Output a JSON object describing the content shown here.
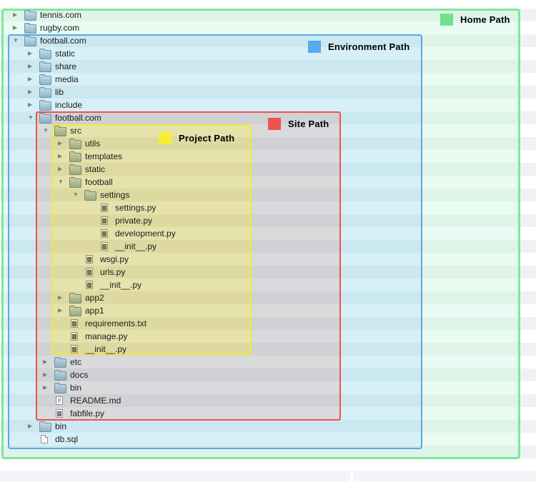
{
  "legend": [
    {
      "id": "home",
      "label": "Home Path",
      "color": "#71e28c",
      "border": "#7ee897"
    },
    {
      "id": "environment",
      "label": "Environment Path",
      "color": "#57a9f0",
      "border": "#5aa7ec"
    },
    {
      "id": "site",
      "label": "Site Path",
      "color": "#ee5350",
      "border": "#ef5251"
    },
    {
      "id": "project",
      "label": "Project Path",
      "color": "#f8ec39",
      "border": "#f6e838"
    }
  ],
  "icons": {
    "collapsed-triangle": "▶",
    "expanded-triangle": "▼",
    "markdown-glyph": "#"
  },
  "tree": {
    "rows": [
      {
        "label": "tennis.com",
        "level": 1,
        "type": "folder",
        "state": "collapsed",
        "zone": "home"
      },
      {
        "label": "rugby.com",
        "level": 1,
        "type": "folder",
        "state": "collapsed",
        "zone": "home"
      },
      {
        "label": "football.com",
        "level": 1,
        "type": "folder",
        "state": "expanded",
        "zone": "env"
      },
      {
        "label": "static",
        "level": 2,
        "type": "folder",
        "state": "collapsed",
        "zone": "env"
      },
      {
        "label": "share",
        "level": 2,
        "type": "folder",
        "state": "collapsed",
        "zone": "env"
      },
      {
        "label": "media",
        "level": 2,
        "type": "folder",
        "state": "collapsed",
        "zone": "env"
      },
      {
        "label": "lib",
        "level": 2,
        "type": "folder",
        "state": "collapsed",
        "zone": "env"
      },
      {
        "label": "include",
        "level": 2,
        "type": "folder",
        "state": "collapsed",
        "zone": "env"
      },
      {
        "label": "football.com",
        "level": 2,
        "type": "folder",
        "state": "expanded",
        "zone": "site"
      },
      {
        "label": "src",
        "level": 3,
        "type": "folder",
        "state": "expanded",
        "zone": "project"
      },
      {
        "label": "utils",
        "level": 4,
        "type": "folder",
        "state": "collapsed",
        "zone": "project"
      },
      {
        "label": "templates",
        "level": 4,
        "type": "folder",
        "state": "collapsed",
        "zone": "project"
      },
      {
        "label": "static",
        "level": 4,
        "type": "folder",
        "state": "collapsed",
        "zone": "project"
      },
      {
        "label": "football",
        "level": 4,
        "type": "folder",
        "state": "expanded",
        "zone": "project"
      },
      {
        "label": "settings",
        "level": 5,
        "type": "folder",
        "state": "expanded",
        "zone": "project"
      },
      {
        "label": "settings.py",
        "level": 6,
        "type": "file",
        "state": "",
        "zone": "project"
      },
      {
        "label": "private.py",
        "level": 6,
        "type": "file",
        "state": "",
        "zone": "project"
      },
      {
        "label": "development.py",
        "level": 6,
        "type": "file",
        "state": "",
        "zone": "project"
      },
      {
        "label": "__init__.py",
        "level": 6,
        "type": "file",
        "state": "",
        "zone": "project"
      },
      {
        "label": "wsgi.py",
        "level": 5,
        "type": "file",
        "state": "",
        "zone": "project"
      },
      {
        "label": "urls.py",
        "level": 5,
        "type": "file",
        "state": "",
        "zone": "project"
      },
      {
        "label": "__init__.py",
        "level": 5,
        "type": "file",
        "state": "",
        "zone": "project"
      },
      {
        "label": "app2",
        "level": 4,
        "type": "folder",
        "state": "collapsed",
        "zone": "project"
      },
      {
        "label": "app1",
        "level": 4,
        "type": "folder",
        "state": "collapsed",
        "zone": "project"
      },
      {
        "label": "requirements.txt",
        "level": 4,
        "type": "file",
        "state": "",
        "zone": "project"
      },
      {
        "label": "manage.py",
        "level": 4,
        "type": "file",
        "state": "",
        "zone": "project"
      },
      {
        "label": "__init__.py",
        "level": 4,
        "type": "file",
        "state": "",
        "zone": "project"
      },
      {
        "label": "etc",
        "level": 3,
        "type": "folder",
        "state": "collapsed",
        "zone": "site"
      },
      {
        "label": "docs",
        "level": 3,
        "type": "folder",
        "state": "collapsed",
        "zone": "site"
      },
      {
        "label": "bin",
        "level": 3,
        "type": "folder",
        "state": "collapsed",
        "zone": "site"
      },
      {
        "label": "README.md",
        "level": 3,
        "type": "file-md",
        "state": "",
        "zone": "site"
      },
      {
        "label": "fabfile.py",
        "level": 3,
        "type": "file",
        "state": "",
        "zone": "site"
      },
      {
        "label": "bin",
        "level": 2,
        "type": "folder",
        "state": "collapsed",
        "zone": "env"
      },
      {
        "label": "db.sql",
        "level": 2,
        "type": "file-plain",
        "state": "",
        "zone": "env"
      }
    ]
  }
}
